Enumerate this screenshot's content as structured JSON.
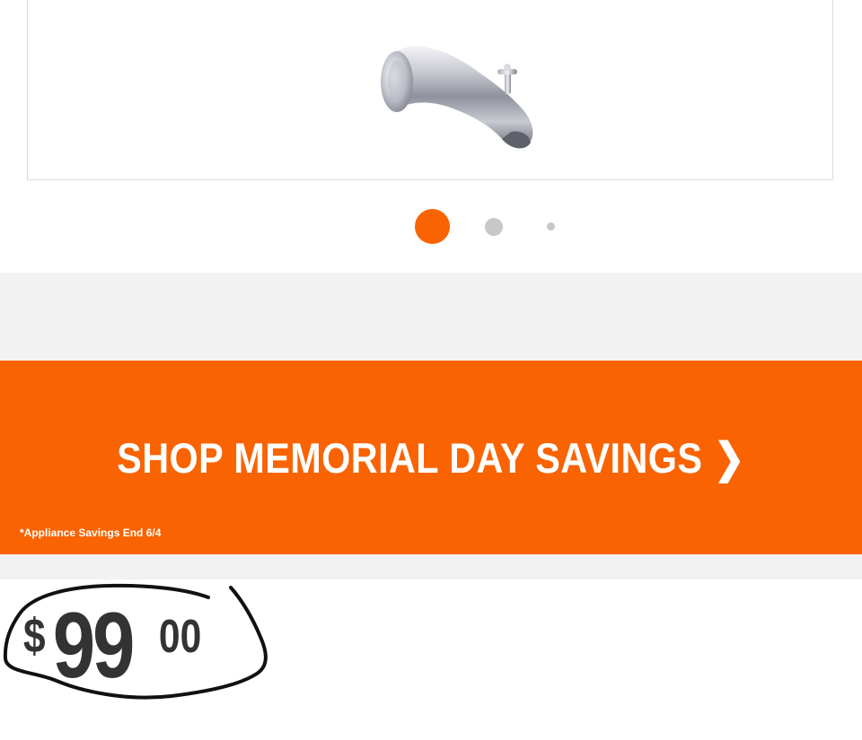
{
  "carousel": {
    "product_image_icon": "tub-spout-image",
    "dots": [
      {
        "state": "active"
      },
      {
        "state": "inactive"
      },
      {
        "state": "inactive"
      }
    ],
    "active_color": "#f96302",
    "inactive_color": "#c8c8c8"
  },
  "promo": {
    "cta_label": "SHOP MEMORIAL DAY SAVINGS",
    "chevron": "❯",
    "disclaimer": "*Appliance Savings End 6/4",
    "background_color": "#f96302"
  },
  "price": {
    "symbol": "$",
    "dollars": "99",
    "cents": "00",
    "annotation_color": "#111111"
  }
}
